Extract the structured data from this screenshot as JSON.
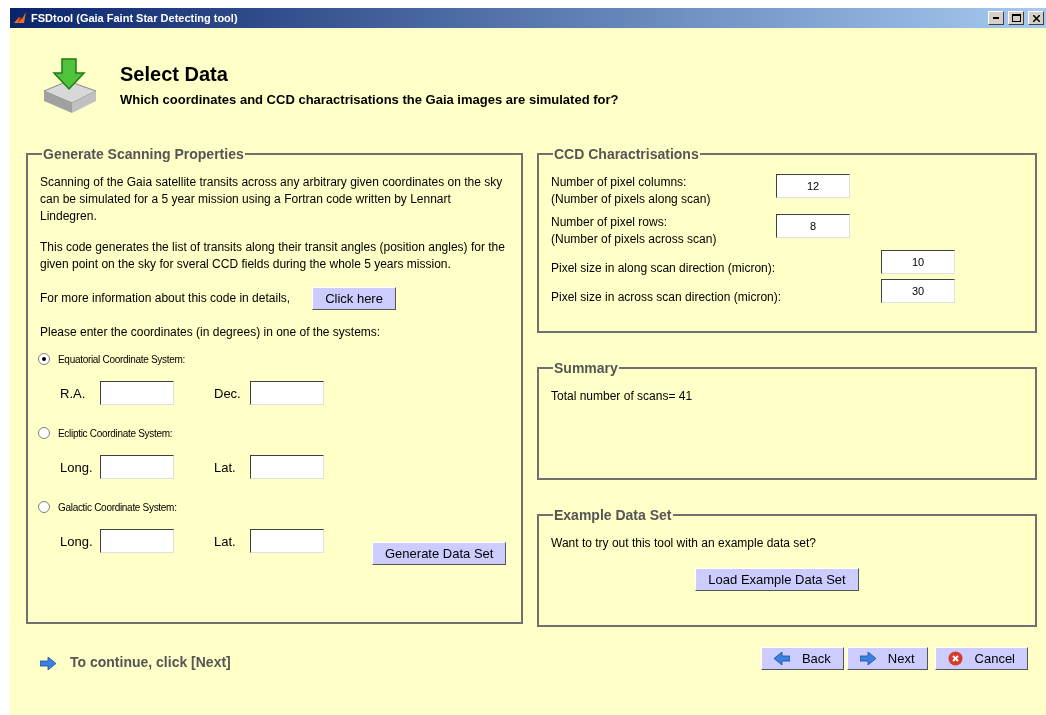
{
  "window": {
    "title": "FSDtool (Gaia Faint Star Detecting tool)"
  },
  "header": {
    "title": "Select Data",
    "subtitle": "Which coordinates and CCD charactrisations the Gaia images are simulated for?"
  },
  "scanning": {
    "title": "Generate Scanning Properties",
    "paragraphs": [
      "Scanning of the Gaia satellite transits across any arbitrary given coordinates on the sky can be simulated for a 5 year mission using a Fortran code written by Lennart Lindegren.",
      "This code generates the list of transits along their transit angles (position angles) for the given point on the sky for sveral CCD fields during the whole 5 years mission."
    ],
    "info_text": "For more information about this code in details,",
    "info_button": "Click here",
    "prompt": "Please enter the coordinates (in degrees) in one of the systems:",
    "systems": [
      {
        "label": "Equatorial Coordinate System:",
        "selected": true,
        "fields": [
          {
            "label": "R.A."
          },
          {
            "label": "Dec."
          }
        ]
      },
      {
        "label": "Ecliptic Coordinate System:",
        "selected": false,
        "fields": [
          {
            "label": "Long."
          },
          {
            "label": "Lat."
          }
        ]
      },
      {
        "label": "Galactic Coordinate System:",
        "selected": false,
        "fields": [
          {
            "label": "Long."
          },
          {
            "label": "Lat."
          }
        ]
      }
    ],
    "generate_button": "Generate Data Set"
  },
  "ccd": {
    "title": "CCD Charactrisations",
    "params": [
      {
        "label": "Number of pixel columns:",
        "sublabel": "(Number of pixels along scan)",
        "value": "12",
        "kind": "short"
      },
      {
        "label": "Number of pixel rows:",
        "sublabel": "(Number of pixels across scan)",
        "value": "8",
        "kind": "short"
      },
      {
        "label": "Pixel size in along scan direction (micron):",
        "value": "10",
        "kind": "long"
      },
      {
        "label": "Pixel size in across scan direction (micron):",
        "value": "30",
        "kind": "long"
      }
    ]
  },
  "summary": {
    "title": "Summary",
    "text": "Total number of scans= 41"
  },
  "example": {
    "title": "Example Data Set",
    "text": "Want to try out this tool with an example data set?",
    "button": "Load Example Data Set"
  },
  "footer": {
    "hint": "To continue, click [Next]",
    "buttons": [
      {
        "label": "Back",
        "kind": "back"
      },
      {
        "label": "Next",
        "kind": "next"
      },
      {
        "label": "Cancel",
        "kind": "cancel"
      }
    ]
  }
}
